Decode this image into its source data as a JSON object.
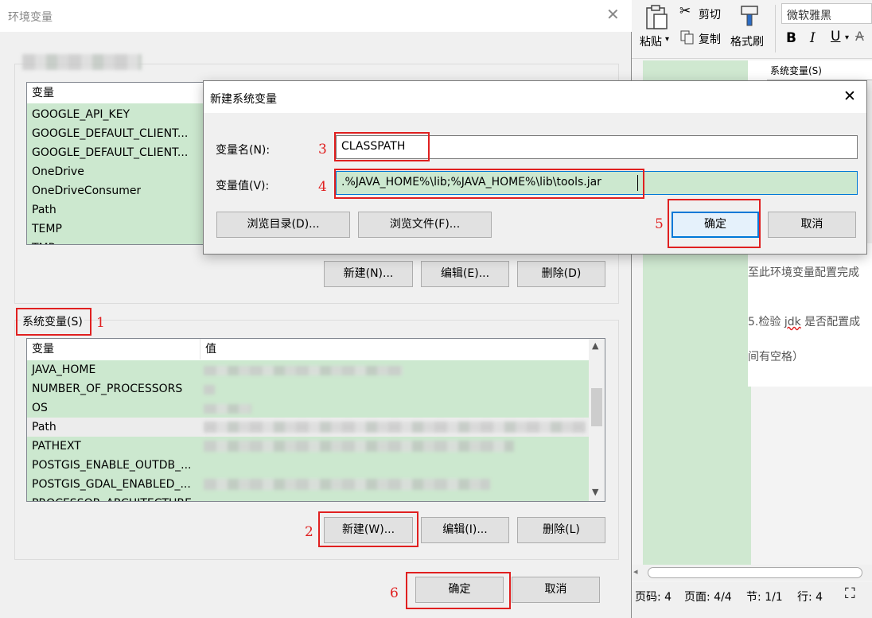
{
  "env_window": {
    "title": "环境变量",
    "user_list": {
      "header_var": "变量",
      "rows": [
        "GOOGLE_API_KEY",
        "GOOGLE_DEFAULT_CLIENT...",
        "GOOGLE_DEFAULT_CLIENT...",
        "OneDrive",
        "OneDriveConsumer",
        "Path",
        "TEMP",
        "TMP"
      ]
    },
    "user_buttons": {
      "new": "新建(N)...",
      "edit": "编辑(E)...",
      "delete": "删除(D)"
    },
    "system_section_label": "系统变量(S)",
    "system_list": {
      "header_var": "变量",
      "header_val": "值",
      "rows": [
        "JAVA_HOME",
        "NUMBER_OF_PROCESSORS",
        "OS",
        "Path",
        "PATHEXT",
        "POSTGIS_ENABLE_OUTDB_...",
        "POSTGIS_GDAL_ENABLED_...",
        "PROCESSOR_ARCHITECTURE"
      ]
    },
    "system_buttons": {
      "new": "新建(W)...",
      "edit": "编辑(I)...",
      "delete": "删除(L)"
    },
    "ok": "确定",
    "cancel": "取消"
  },
  "new_var_dialog": {
    "title": "新建系统变量",
    "name_label": "变量名(N):",
    "name_value": "CLASSPATH",
    "value_label": "变量值(V):",
    "value_value": ".%JAVA_HOME%\\lib;%JAVA_HOME%\\lib\\tools.jar",
    "browse_dir": "浏览目录(D)...",
    "browse_file": "浏览文件(F)...",
    "ok": "确定",
    "cancel": "取消"
  },
  "annotations": [
    "1",
    "2",
    "3",
    "4",
    "5",
    "6"
  ],
  "word": {
    "paste": "粘贴",
    "cut": "剪切",
    "copy": "复制",
    "format_painter": "格式刷",
    "font": "微软雅黑",
    "bold": "B",
    "italic": "I",
    "underline": "U",
    "doc_label": "系统变量(S)",
    "line1": "至此环境变量配置完成",
    "line2_a": "5.检验 ",
    "line2_b": "jdk",
    "line2_c": " 是否配置成",
    "line3": "间有空格）",
    "status": {
      "page": "页码: 4",
      "pages": "页面: 4/4",
      "section": "节: 1/1",
      "row": "行: 4"
    }
  },
  "colors": {
    "list_green": "#cce8cf",
    "annotation_red": "#e02020",
    "focus_blue": "#0078d7"
  }
}
